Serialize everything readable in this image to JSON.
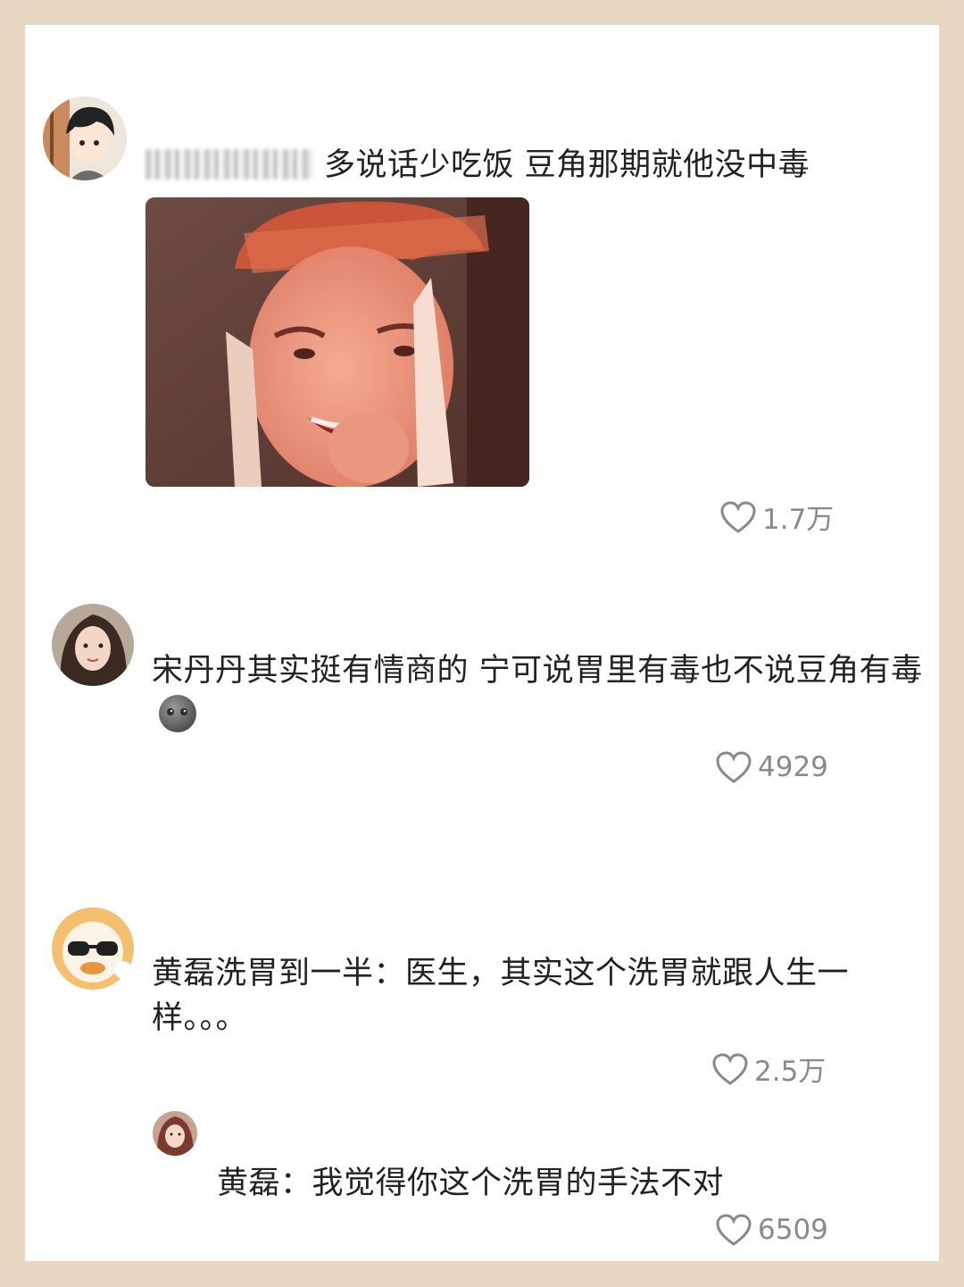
{
  "comments": [
    {
      "text": "多说话少吃饭 豆角那期就他没中毒",
      "likes": "1.7万",
      "has_image": true
    },
    {
      "text": "宋丹丹其实挺有情商的 宁可说胃里有毒也不说豆角有毒",
      "emoji": "moon-face-emoji",
      "likes": "4929"
    },
    {
      "text": "黄磊洗胃到一半：医生，其实这个洗胃就跟人生一样。。。",
      "likes": "2.5万",
      "reply": {
        "text": "黄磊：我觉得你这个洗胃的手法不对",
        "likes": "6509"
      }
    }
  ],
  "icons": {
    "like": "heart-outline-icon",
    "moon": "moon-face-emoji"
  },
  "colors": {
    "frame": "#e6d8c3",
    "card": "#ffffff",
    "text": "#222222",
    "meta": "#8a8a8a"
  }
}
